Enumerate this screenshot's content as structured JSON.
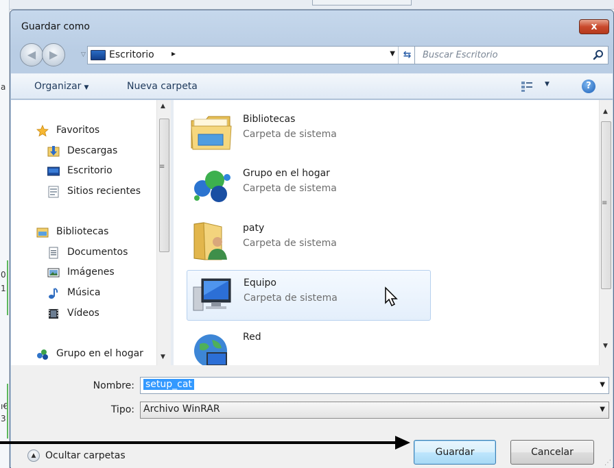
{
  "window": {
    "title": "Guardar como",
    "close_label": "x"
  },
  "address": {
    "location": "Escritorio",
    "separator": "▸",
    "search_placeholder": "Buscar Escritorio"
  },
  "toolbar": {
    "organize_label": "Organizar",
    "new_folder_label": "Nueva carpeta",
    "help_label": "?"
  },
  "nav": {
    "items": [
      {
        "label": "Favoritos",
        "icon": "star-icon"
      },
      {
        "label": "Descargas",
        "icon": "downloads-icon"
      },
      {
        "label": "Escritorio",
        "icon": "desktop-icon"
      },
      {
        "label": "Sitios recientes",
        "icon": "recent-places-icon"
      },
      {
        "label": "Bibliotecas",
        "icon": "libraries-icon"
      },
      {
        "label": "Documentos",
        "icon": "documents-icon"
      },
      {
        "label": "Imágenes",
        "icon": "pictures-icon"
      },
      {
        "label": "Música",
        "icon": "music-icon"
      },
      {
        "label": "Vídeos",
        "icon": "videos-icon"
      },
      {
        "label": "Grupo en el hogar",
        "icon": "homegroup-icon"
      }
    ]
  },
  "content": {
    "items": [
      {
        "name": "Bibliotecas",
        "desc": "Carpeta de sistema",
        "icon": "libraries-folder-icon"
      },
      {
        "name": "Grupo en el hogar",
        "desc": "Carpeta de sistema",
        "icon": "homegroup-icon"
      },
      {
        "name": "paty",
        "desc": "Carpeta de sistema",
        "icon": "user-folder-icon"
      },
      {
        "name": "Equipo",
        "desc": "Carpeta de sistema",
        "icon": "computer-icon"
      },
      {
        "name": "Red",
        "desc": "",
        "icon": "network-icon"
      }
    ]
  },
  "form": {
    "name_label": "Nombre:",
    "name_value": "setup_cat",
    "type_label": "Tipo:",
    "type_value": "Archivo WinRAR",
    "hide_folders_label": "Ocultar carpetas",
    "save_label": "Guardar",
    "cancel_label": "Cancelar"
  },
  "colors": {
    "frame": "#bccfe5",
    "selection": "#e4effb",
    "highlight": "#3399ff",
    "close": "#c9492c"
  }
}
